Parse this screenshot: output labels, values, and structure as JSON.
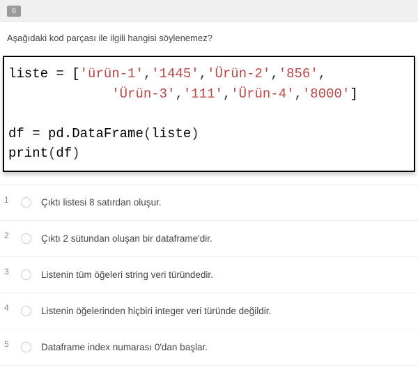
{
  "question": {
    "number": "6",
    "text": "Aşağıdaki kod parçası ile ilgili hangisi söylenemez?"
  },
  "code": {
    "line1_var": "liste",
    "line1_eq": " = ",
    "line1_open": "[",
    "line1_s1": "'ürün-1'",
    "line1_c1": ",",
    "line1_s2": "'1445'",
    "line1_c2": ",",
    "line1_s3": "'Ürün-2'",
    "line1_c3": ",",
    "line1_s4": "'856'",
    "line1_c4": ",",
    "line2_pad": "             ",
    "line2_s5": "'Ürün-3'",
    "line2_c5": ",",
    "line2_s6": "'111'",
    "line2_c6": ",",
    "line2_s7": "'Ürün-4'",
    "line2_c7": ",",
    "line2_s8": "'8000'",
    "line2_close": "]",
    "blank": " ",
    "line3_df": "df",
    "line3_eq": " = ",
    "line3_call": "pd.DataFrame",
    "line3_open": "(",
    "line3_arg": "liste",
    "line3_close": ")",
    "line4_print": "print",
    "line4_open": "(",
    "line4_arg": "df",
    "line4_close": ")"
  },
  "answers": [
    {
      "num": "1",
      "text": "Çıktı listesi 8 satırdan oluşur."
    },
    {
      "num": "2",
      "text": "Çıktı 2 sütundan oluşan bir dataframe'dir."
    },
    {
      "num": "3",
      "text": "Listenin tüm öğeleri string veri türündedir."
    },
    {
      "num": "4",
      "text": "Listenin öğelerinden hiçbiri integer veri türünde değildir."
    },
    {
      "num": "5",
      "text": "Dataframe index numarası 0'dan başlar."
    }
  ]
}
